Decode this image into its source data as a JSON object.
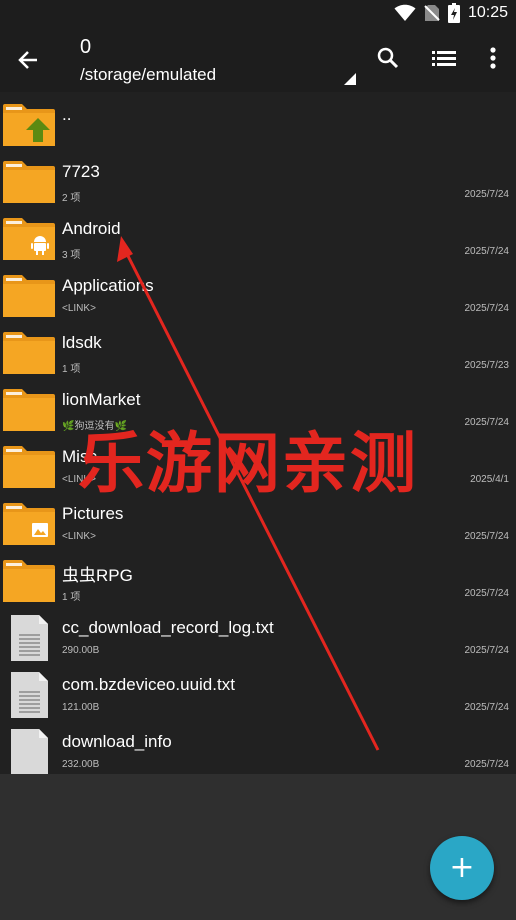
{
  "status_bar": {
    "time": "10:25",
    "icons": [
      "wifi-icon",
      "no-sim-icon",
      "battery-charging-icon"
    ]
  },
  "app_bar": {
    "title": "0",
    "path": "/storage/emulated",
    "actions": [
      "search-icon",
      "list-view-icon",
      "more-vert-icon"
    ]
  },
  "files": [
    {
      "name": "..",
      "meta": "",
      "date": "",
      "icon": "folder-up-icon"
    },
    {
      "name": "7723",
      "meta": "2 项",
      "date": "2025/7/24",
      "icon": "folder-icon"
    },
    {
      "name": "Android",
      "meta": "3 项",
      "date": "2025/7/24",
      "icon": "folder-android-icon"
    },
    {
      "name": "Applications",
      "meta": "<LINK>",
      "date": "2025/7/24",
      "icon": "folder-icon"
    },
    {
      "name": "ldsdk",
      "meta": "1 项",
      "date": "2025/7/23",
      "icon": "folder-icon"
    },
    {
      "name": "lionMarket",
      "meta": "🌿狗逗没有🌿",
      "date": "2025/7/24",
      "icon": "folder-icon"
    },
    {
      "name": "Misc",
      "meta": "<LINK>",
      "date": "2025/4/1",
      "icon": "folder-icon"
    },
    {
      "name": "Pictures",
      "meta": "<LINK>",
      "date": "2025/7/24",
      "icon": "folder-pictures-icon"
    },
    {
      "name": "虫虫RPG",
      "meta": "1 项",
      "date": "2025/7/24",
      "icon": "folder-icon"
    },
    {
      "name": "cc_download_record_log.txt",
      "meta": "290.00B",
      "date": "2025/7/24",
      "icon": "text-file-icon"
    },
    {
      "name": "com.bzdeviceo.uuid.txt",
      "meta": "121.00B",
      "date": "2025/7/24",
      "icon": "text-file-icon"
    },
    {
      "name": "download_info",
      "meta": "232.00B",
      "date": "2025/7/24",
      "icon": "blank-file-icon"
    }
  ],
  "watermark": "乐游网亲测",
  "fab": {
    "label": "+"
  },
  "colors": {
    "folder": "#f5a623",
    "accent": "#2aa7c6",
    "annotation": "#e3261f",
    "appbar": "#1d1d1d"
  }
}
